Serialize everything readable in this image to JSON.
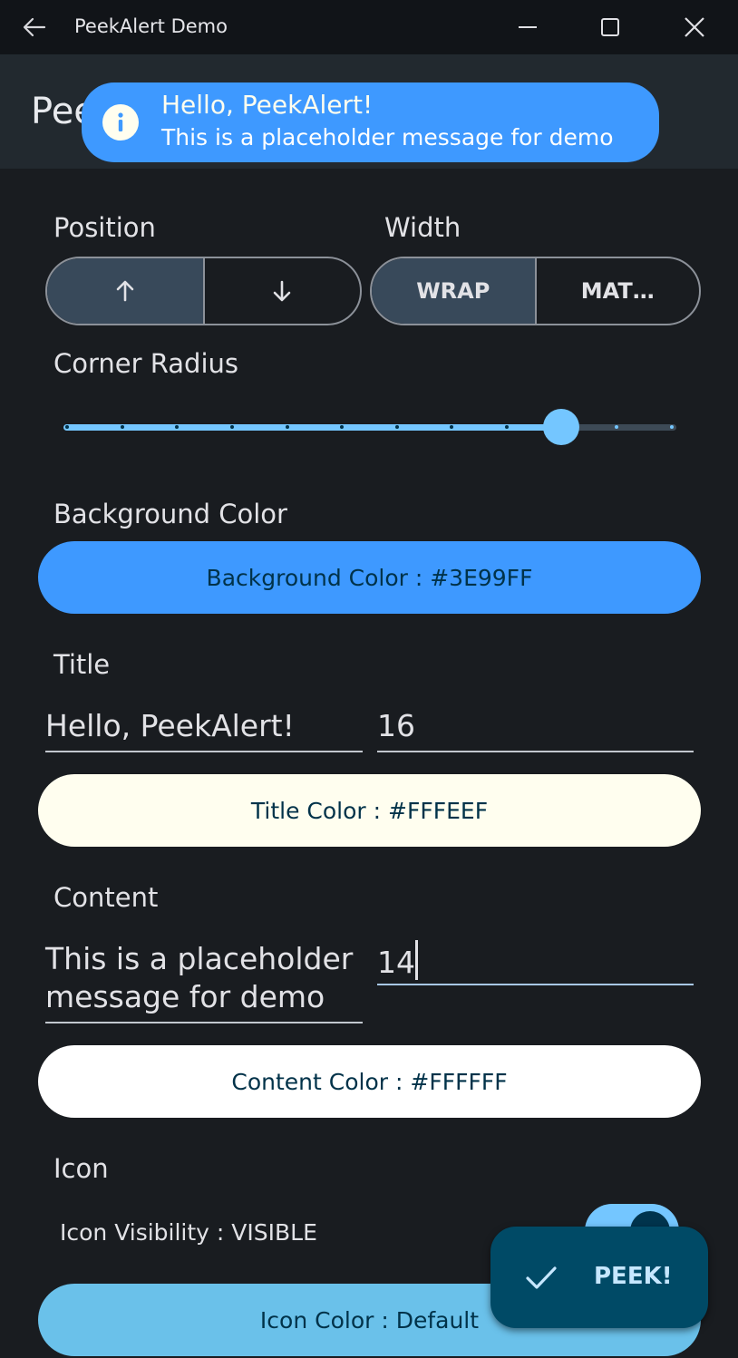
{
  "window": {
    "title": "PeekAlert Demo"
  },
  "appbar": {
    "title": "PeekAlert"
  },
  "peek_alert": {
    "title": "Hello, PeekAlert!",
    "content": "This is a placeholder message for demo",
    "icon": "info-icon",
    "background": "#3E99FF"
  },
  "position": {
    "label": "Position",
    "options": [
      "up-arrow-icon",
      "down-arrow-icon"
    ],
    "selected": "up"
  },
  "width": {
    "label": "Width",
    "options": [
      "WRAP",
      "MAT…"
    ],
    "selected": "WRAP"
  },
  "corner_radius": {
    "label": "Corner Radius",
    "steps": 11,
    "value_step": 9
  },
  "background_color": {
    "label": "Background Color",
    "button": "Background Color : #3E99FF",
    "color": "#3E99FF"
  },
  "title_section": {
    "label": "Title",
    "text_value": "Hello, PeekAlert!",
    "size_value": "16",
    "color_button": "Title Color : #FFFEEF",
    "color": "#FFFEEF"
  },
  "content_section": {
    "label": "Content",
    "text_value": "This is a placeholder message for demo",
    "size_value": "14",
    "color_button": "Content Color : #FFFFFF",
    "color": "#FFFFFF"
  },
  "icon_section": {
    "label": "Icon",
    "visibility_text": "Icon Visibility : VISIBLE",
    "visibility_on": true,
    "color_button": "Icon Color : Default"
  },
  "fab": {
    "label": "PEEK!",
    "icon": "check-icon"
  },
  "colors": {
    "accent": "#74C6FF",
    "background": "#191C20",
    "fab": "#004A66"
  }
}
